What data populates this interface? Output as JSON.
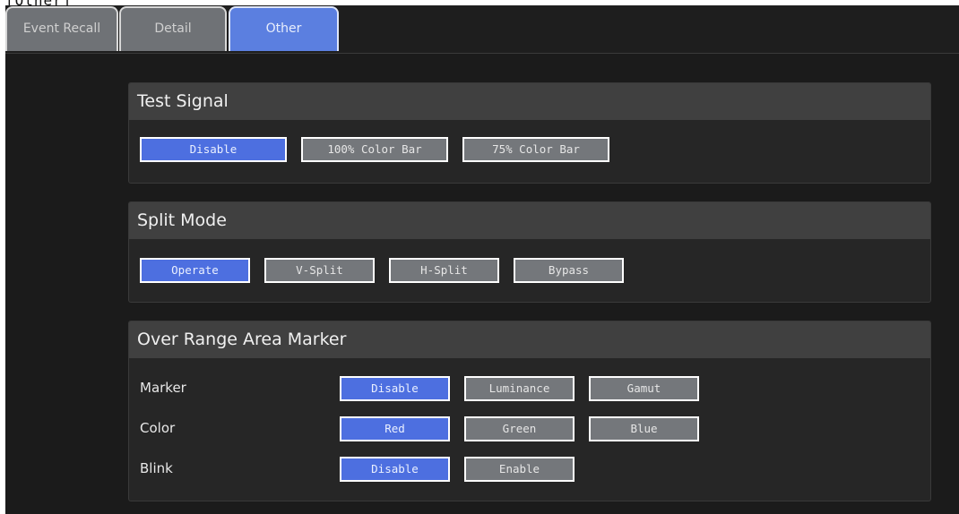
{
  "page_header": "[Other]",
  "tabs": [
    {
      "label": "Event Recall",
      "active": false
    },
    {
      "label": "Detail",
      "active": false
    },
    {
      "label": "Other",
      "active": true
    }
  ],
  "test_signal": {
    "title": "Test Signal",
    "options": [
      "Disable",
      "100% Color Bar",
      "75% Color Bar"
    ],
    "selected": "Disable"
  },
  "split_mode": {
    "title": "Split Mode",
    "options": [
      "Operate",
      "V-Split",
      "H-Split",
      "Bypass"
    ],
    "selected": "Operate"
  },
  "over_range": {
    "title": "Over Range Area Marker",
    "rows": [
      {
        "label": "Marker",
        "options": [
          "Disable",
          "Luminance",
          "Gamut"
        ],
        "selected": "Disable"
      },
      {
        "label": "Color",
        "options": [
          "Red",
          "Green",
          "Blue"
        ],
        "selected": "Red"
      },
      {
        "label": "Blink",
        "options": [
          "Disable",
          "Enable"
        ],
        "selected": "Disable"
      }
    ]
  },
  "colors": {
    "selected_button": "#4d6fe0",
    "unselected_button": "#74777b",
    "background": "#1b1b1b",
    "panel_header": "#404040"
  }
}
